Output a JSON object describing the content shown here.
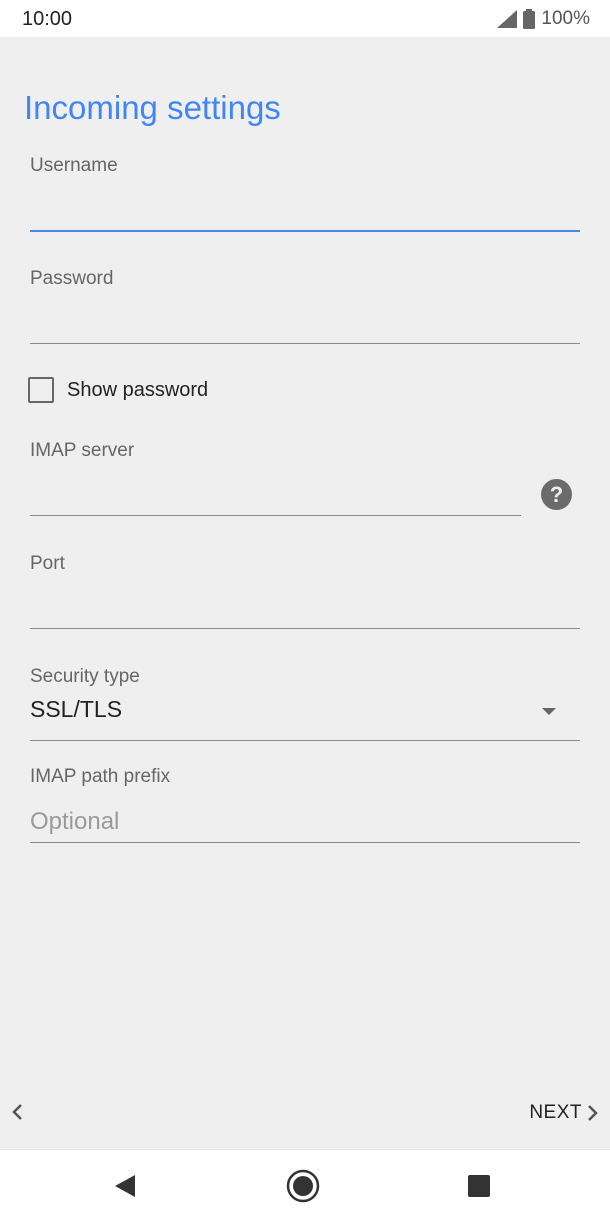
{
  "status_bar": {
    "time": "10:00",
    "battery_text": "100%",
    "icons": [
      "signal-icon",
      "battery-icon"
    ]
  },
  "page": {
    "title": "Incoming settings"
  },
  "form": {
    "username": {
      "label": "Username",
      "value": ""
    },
    "password": {
      "label": "Password",
      "value": ""
    },
    "show_password": {
      "label": "Show password",
      "checked": false
    },
    "imap_server": {
      "label": "IMAP server",
      "value": "",
      "help_icon": "help-icon"
    },
    "port": {
      "label": "Port",
      "value": ""
    },
    "security_type": {
      "label": "Security type",
      "value": "SSL/TLS"
    },
    "imap_path_prefix": {
      "label": "IMAP path prefix",
      "placeholder": "Optional",
      "value": ""
    }
  },
  "footer": {
    "next_label": "NEXT"
  },
  "nav_bar": {
    "buttons": [
      "back-icon",
      "home-icon",
      "recents-icon"
    ]
  },
  "colors": {
    "accent": "#4285f4",
    "background": "#efefef",
    "focused_underline": "#4a86e8"
  }
}
